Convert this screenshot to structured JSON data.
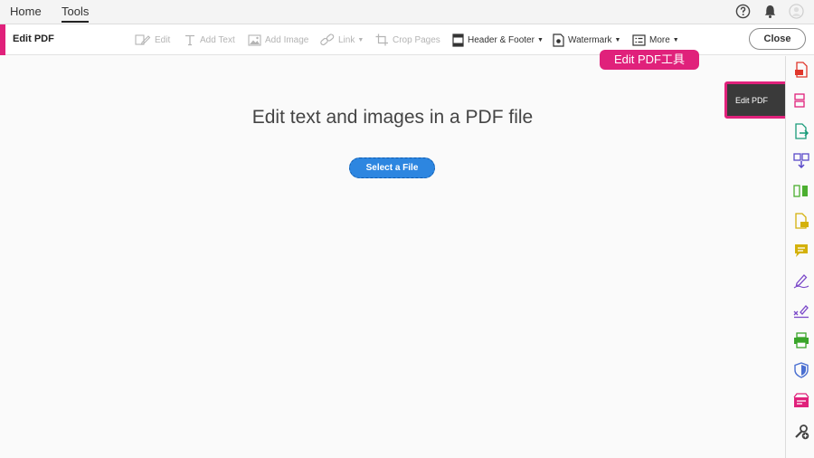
{
  "top_menu": {
    "home": "Home",
    "tools": "Tools"
  },
  "toolbar": {
    "title": "Edit PDF",
    "tools": [
      {
        "label": "Edit",
        "icon": "edit-icon",
        "enabled": false,
        "dropdown": false
      },
      {
        "label": "Add Text",
        "icon": "text-icon",
        "enabled": false,
        "dropdown": false
      },
      {
        "label": "Add Image",
        "icon": "image-icon",
        "enabled": false,
        "dropdown": false
      },
      {
        "label": "Link",
        "icon": "link-icon",
        "enabled": false,
        "dropdown": true
      },
      {
        "label": "Crop Pages",
        "icon": "crop-icon",
        "enabled": false,
        "dropdown": false
      },
      {
        "label": "Header & Footer",
        "icon": "header-footer-icon",
        "enabled": true,
        "dropdown": true
      },
      {
        "label": "Watermark",
        "icon": "watermark-icon",
        "enabled": true,
        "dropdown": true
      },
      {
        "label": "More",
        "icon": "more-icon",
        "enabled": true,
        "dropdown": true
      }
    ],
    "close_label": "Close"
  },
  "main": {
    "heading": "Edit text and images in a PDF file",
    "select_button": "Select a File"
  },
  "annotation": {
    "label": "Edit PDF工具"
  },
  "popover": {
    "label": "Edit PDF"
  },
  "colors": {
    "accent": "#e0217b",
    "primary_button": "#2d86e0"
  },
  "right_rail_icons": [
    "create-pdf-icon",
    "edit-pdf-icon",
    "export-pdf-icon",
    "combine-files-icon",
    "organize-pages-icon",
    "enhance-scans-icon",
    "comment-icon",
    "fill-sign-icon",
    "send-for-signature-icon",
    "print-production-icon",
    "protect-icon",
    "prepare-form-icon",
    "customize-tools-icon"
  ]
}
